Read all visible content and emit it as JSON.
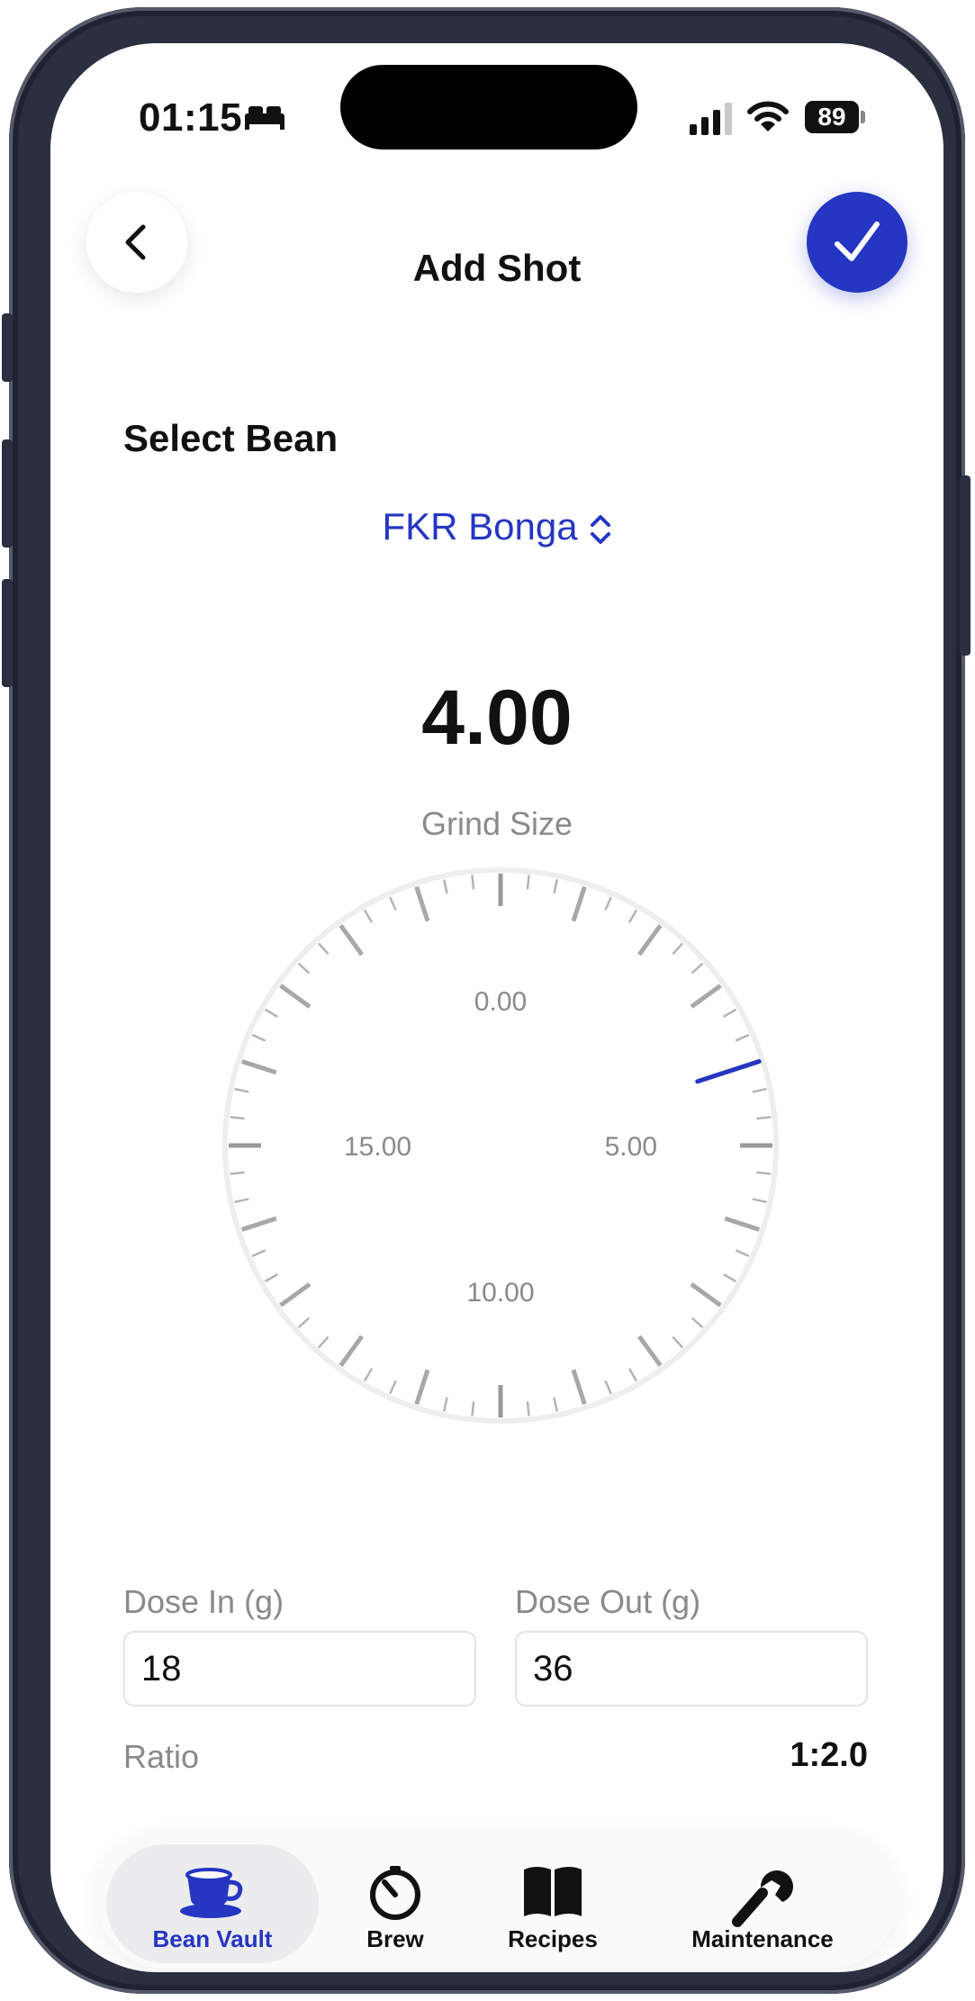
{
  "status_bar": {
    "time": "01:15",
    "battery": "89"
  },
  "header": {
    "title": "Add Shot"
  },
  "bean": {
    "section_label": "Select Bean",
    "selected": "FKR Bonga"
  },
  "grind": {
    "value": "4.00",
    "label": "Grind Size",
    "dial_labels": [
      "0.00",
      "5.00",
      "10.00",
      "15.00"
    ],
    "dial_max": 20,
    "indicator_value": 4
  },
  "dose": {
    "in_label": "Dose In (g)",
    "in_value": "18",
    "out_label": "Dose Out (g)",
    "out_value": "36",
    "ratio_label": "Ratio",
    "ratio_value": "1:2.0"
  },
  "tabs": [
    {
      "label": "Bean Vault",
      "icon": "coffee-cup-icon",
      "active": true
    },
    {
      "label": "Brew",
      "icon": "stopwatch-icon",
      "active": false
    },
    {
      "label": "Recipes",
      "icon": "book-icon",
      "active": false
    },
    {
      "label": "Maintenance",
      "icon": "wrench-icon",
      "active": false
    }
  ],
  "colors": {
    "accent": "#2536c2",
    "secondary_text": "#8a8a8a"
  }
}
